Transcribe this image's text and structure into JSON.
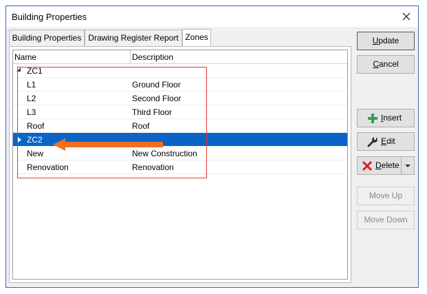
{
  "window": {
    "title": "Building Properties"
  },
  "tabs": [
    {
      "label": "Building Properties"
    },
    {
      "label": "Drawing Register Report"
    },
    {
      "label": "Zones"
    }
  ],
  "grid": {
    "columns": {
      "name": "Name",
      "description": "Description"
    },
    "rows": [
      {
        "name": "ZC1",
        "description": "",
        "expander": "expanded"
      },
      {
        "name": "L1",
        "description": "Ground Floor"
      },
      {
        "name": "L2",
        "description": "Second Floor"
      },
      {
        "name": "L3",
        "description": "Third Floor"
      },
      {
        "name": "Roof",
        "description": "Roof"
      },
      {
        "name": "ZC2",
        "description": "",
        "expander": "collapsed",
        "selected": true
      },
      {
        "name": "New",
        "description": "New Construction"
      },
      {
        "name": "Renovation",
        "description": "Renovation"
      }
    ]
  },
  "buttons": {
    "update": {
      "pre": "",
      "u": "U",
      "post": "pdate"
    },
    "cancel": {
      "pre": "",
      "u": "C",
      "post": "ancel"
    },
    "insert": {
      "pre": "",
      "u": "I",
      "post": "nsert",
      "icon": "plus-icon"
    },
    "edit": {
      "pre": "",
      "u": "E",
      "post": "dit",
      "icon": "wrench-icon"
    },
    "delete": {
      "pre": "",
      "u": "D",
      "post": "elete",
      "icon": "x-icon"
    },
    "move_up": "Move Up",
    "move_down": "Move Down"
  },
  "colors": {
    "selection": "#0a64c8",
    "highlight_box": "#e03a3a",
    "arrow": "#f07020"
  }
}
